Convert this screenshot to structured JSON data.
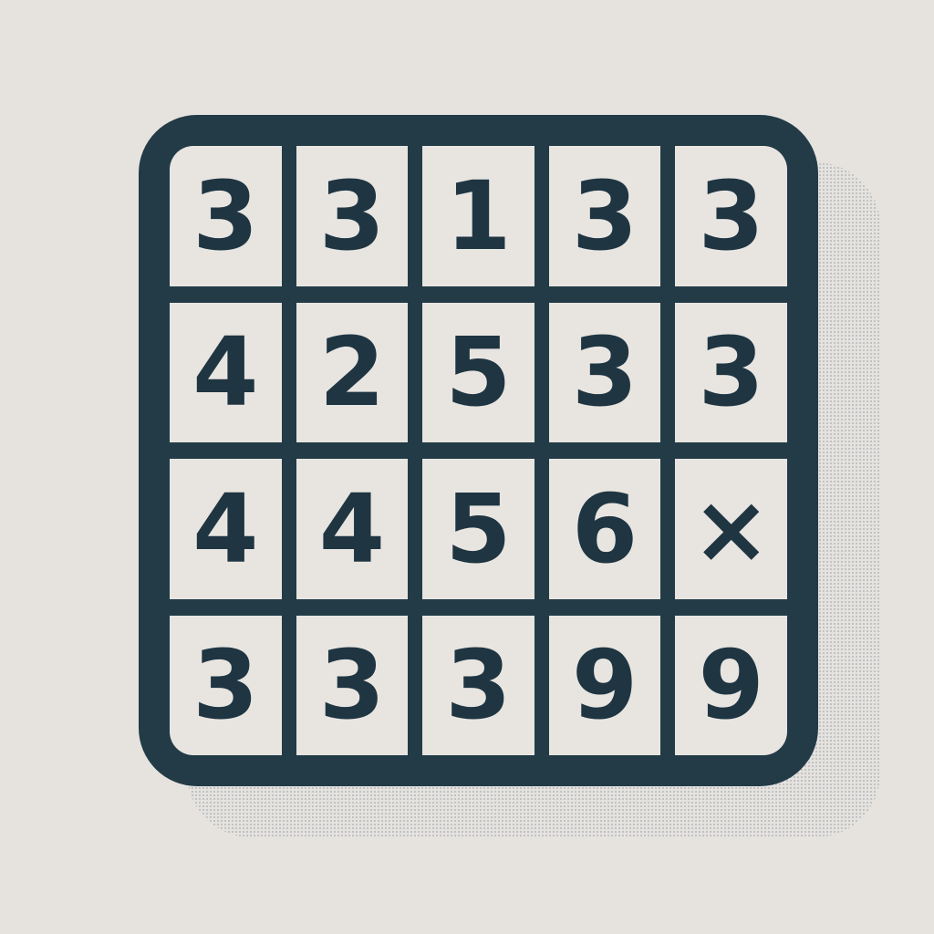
{
  "board": {
    "rows": [
      [
        "3",
        "3",
        "1",
        "3",
        "3"
      ],
      [
        "4",
        "2",
        "5",
        "3",
        "3"
      ],
      [
        "4",
        "4",
        "5",
        "6",
        "×"
      ],
      [
        "3",
        "3",
        "3",
        "9",
        "9"
      ]
    ]
  },
  "colors": {
    "background": "#e6e3df",
    "board_frame": "#223b47",
    "cell_fill": "#e8e5e1",
    "digit": "#1f3542"
  }
}
